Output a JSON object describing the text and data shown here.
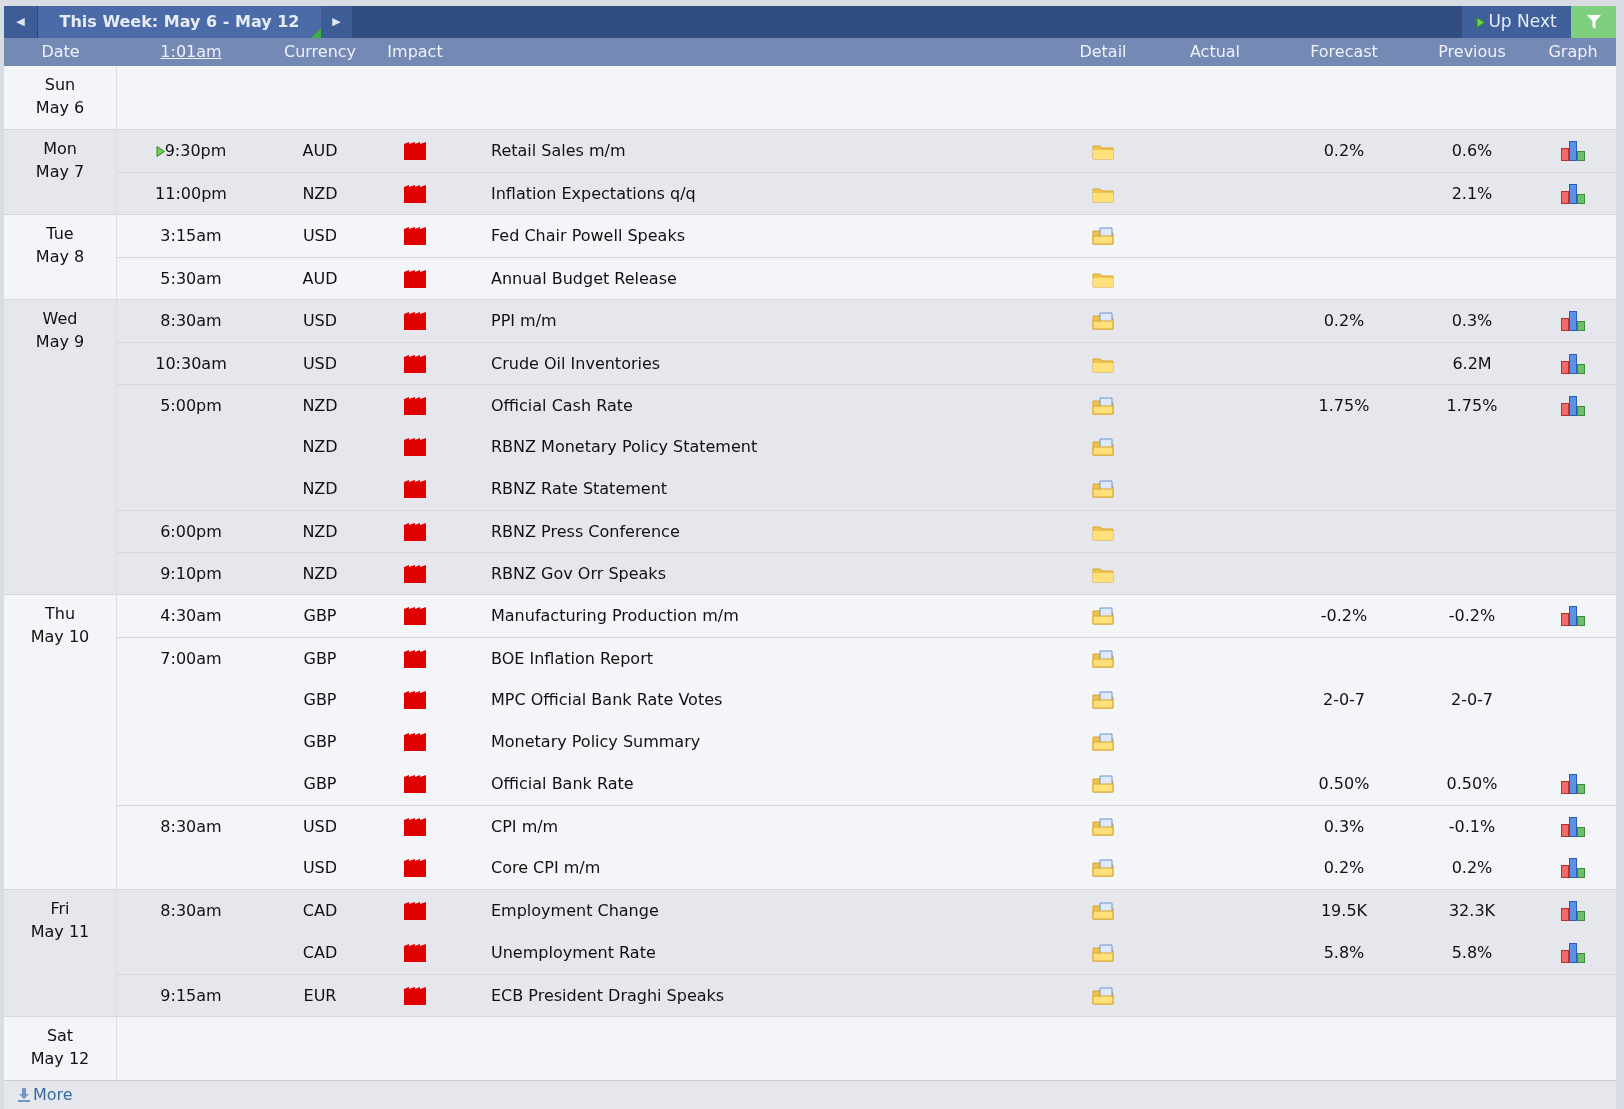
{
  "toolbar": {
    "prev_label": "◀",
    "week_label": "This Week: May 6 - May 12",
    "next_label": "▶",
    "up_next": "Up Next"
  },
  "columns": {
    "date": "Date",
    "time": "1:01am",
    "currency": "Currency",
    "impact": "Impact",
    "detail": "Detail",
    "actual": "Actual",
    "forecast": "Forecast",
    "previous": "Previous",
    "graph": "Graph"
  },
  "days": [
    {
      "weekday": "Sun",
      "date": "May 6"
    },
    {
      "weekday": "Mon",
      "date": "May 7",
      "events": [
        {
          "time": "9:30pm",
          "up_next": true,
          "currency": "AUD",
          "title": "Retail Sales m/m",
          "has_notes": false,
          "forecast": "0.2%",
          "previous": "0.6%",
          "graph": true
        },
        {
          "time": "11:00pm",
          "currency": "NZD",
          "title": "Inflation Expectations q/q",
          "has_notes": false,
          "previous": "2.1%",
          "graph": true
        }
      ]
    },
    {
      "weekday": "Tue",
      "date": "May 8",
      "events": [
        {
          "time": "3:15am",
          "currency": "USD",
          "title": "Fed Chair Powell Speaks",
          "has_notes": true
        },
        {
          "time": "5:30am",
          "currency": "AUD",
          "title": "Annual Budget Release",
          "has_notes": false
        }
      ]
    },
    {
      "weekday": "Wed",
      "date": "May 9",
      "events": [
        {
          "time": "8:30am",
          "currency": "USD",
          "title": "PPI m/m",
          "has_notes": true,
          "forecast": "0.2%",
          "previous": "0.3%",
          "graph": true
        },
        {
          "time": "10:30am",
          "currency": "USD",
          "title": "Crude Oil Inventories",
          "has_notes": false,
          "previous": "6.2M",
          "graph": true
        },
        {
          "time": "5:00pm",
          "currency": "NZD",
          "title": "Official Cash Rate",
          "has_notes": true,
          "forecast": "1.75%",
          "previous": "1.75%",
          "graph": true
        },
        {
          "currency": "NZD",
          "title": "RBNZ Monetary Policy Statement",
          "has_notes": true
        },
        {
          "currency": "NZD",
          "title": "RBNZ Rate Statement",
          "has_notes": true
        },
        {
          "time": "6:00pm",
          "currency": "NZD",
          "title": "RBNZ Press Conference",
          "has_notes": false
        },
        {
          "time": "9:10pm",
          "currency": "NZD",
          "title": "RBNZ Gov Orr Speaks",
          "has_notes": false
        }
      ]
    },
    {
      "weekday": "Thu",
      "date": "May 10",
      "events": [
        {
          "time": "4:30am",
          "currency": "GBP",
          "title": "Manufacturing Production m/m",
          "has_notes": true,
          "forecast": "-0.2%",
          "previous": "-0.2%",
          "graph": true
        },
        {
          "time": "7:00am",
          "currency": "GBP",
          "title": "BOE Inflation Report",
          "has_notes": true
        },
        {
          "currency": "GBP",
          "title": "MPC Official Bank Rate Votes",
          "has_notes": true,
          "forecast": "2-0-7",
          "previous": "2-0-7"
        },
        {
          "currency": "GBP",
          "title": "Monetary Policy Summary",
          "has_notes": true
        },
        {
          "currency": "GBP",
          "title": "Official Bank Rate",
          "has_notes": true,
          "forecast": "0.50%",
          "previous": "0.50%",
          "graph": true
        },
        {
          "time": "8:30am",
          "currency": "USD",
          "title": "CPI m/m",
          "has_notes": true,
          "forecast": "0.3%",
          "previous": "-0.1%",
          "graph": true
        },
        {
          "currency": "USD",
          "title": "Core CPI m/m",
          "has_notes": true,
          "forecast": "0.2%",
          "previous": "0.2%",
          "graph": true
        }
      ]
    },
    {
      "weekday": "Fri",
      "date": "May 11",
      "events": [
        {
          "time": "8:30am",
          "currency": "CAD",
          "title": "Employment Change",
          "has_notes": true,
          "forecast": "19.5K",
          "previous": "32.3K",
          "graph": true
        },
        {
          "currency": "CAD",
          "title": "Unemployment Rate",
          "has_notes": true,
          "forecast": "5.8%",
          "previous": "5.8%",
          "graph": true
        },
        {
          "time": "9:15am",
          "currency": "EUR",
          "title": "ECB President Draghi Speaks",
          "has_notes": true
        }
      ]
    },
    {
      "weekday": "Sat",
      "date": "May 12"
    }
  ],
  "footer": {
    "more": "More"
  }
}
